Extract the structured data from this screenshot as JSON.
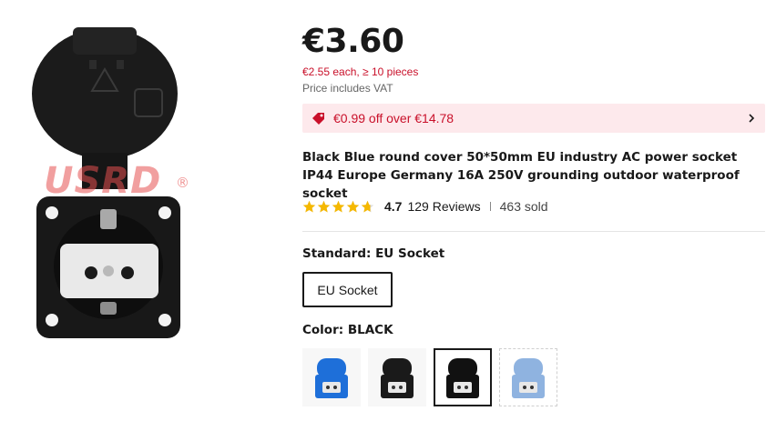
{
  "product": {
    "price": "€3.60",
    "bulk_price": "€2.55 each, ≥ 10 pieces",
    "vat_note": "Price includes VAT",
    "coupon_text": "€0.99 off over €14.78",
    "title": "Black Blue round cover 50*50mm EU industry AC power socket IP44 Europe Germany 16A 250V grounding outdoor waterproof socket",
    "rating": "4.7",
    "rating_fraction": 0.94,
    "reviews": "129 Reviews",
    "sold": "463 sold",
    "watermark": "USRD",
    "watermark_mark": "®"
  },
  "standard": {
    "label": "Standard: EU Socket",
    "options": [
      "EU Socket"
    ],
    "selected": "EU Socket"
  },
  "color": {
    "label": "Color: BLACK",
    "swatches": [
      {
        "name": "blue",
        "color": "#1e6fd9"
      },
      {
        "name": "black",
        "color": "#1a1a1a"
      },
      {
        "name": "black-open",
        "color": "#111111",
        "selected": true
      },
      {
        "name": "light-blue",
        "color": "#8fb3e0"
      }
    ]
  },
  "colors": {
    "accent": "#c9102a",
    "coupon_bg": "#fde9ec",
    "star": "#f5b800",
    "text": "#191919"
  },
  "icons": {
    "coupon": "tag-icon",
    "chevron": "chevron-right-icon",
    "star": "star-icon"
  }
}
